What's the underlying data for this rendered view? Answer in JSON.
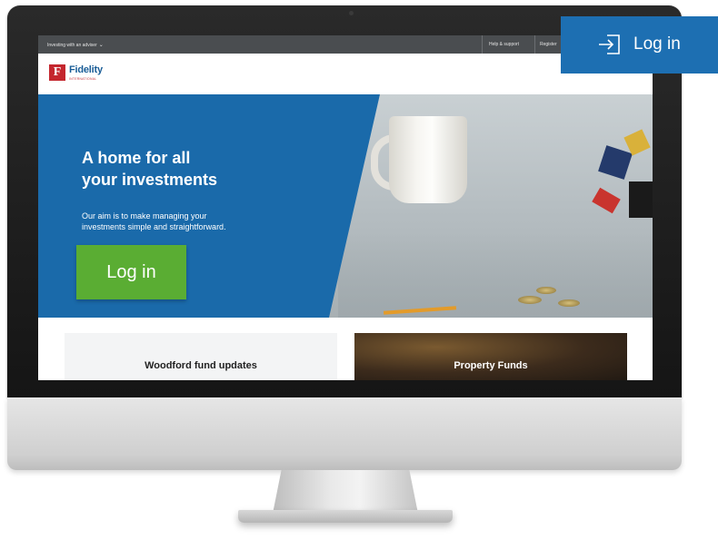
{
  "topbar": {
    "adviser_label": "Investing with an adviser",
    "help_label": "Help & support",
    "register_label": "Register"
  },
  "header": {
    "logo_text": "Fidelity",
    "logo_subtext": "INTERNATIONAL"
  },
  "hero": {
    "title_line1": "A home for all",
    "title_line2": "your investments",
    "description_line1": "Our aim is to make managing your",
    "description_line2": "investments simple and straightforward.",
    "login_label": "Log in"
  },
  "cards": [
    {
      "label": "Woodford fund updates"
    },
    {
      "label": "Property Funds"
    }
  ],
  "floating_login": {
    "label": "Log in"
  },
  "icons": {
    "adviser_dropdown": "chevron-down-icon",
    "login": "sign-in-icon",
    "logo": "fidelity-logo-icon"
  },
  "colors": {
    "hero_blue": "#1a6aaa",
    "login_green": "#5aad33",
    "float_blue": "#1d6fb2",
    "topbar": "#4a4d50",
    "logo_red": "#c4262e"
  }
}
